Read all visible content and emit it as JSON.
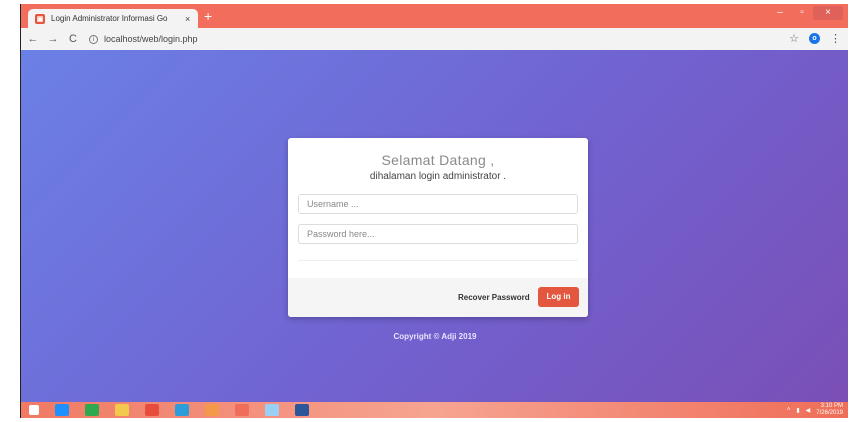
{
  "browser": {
    "tab_title": "Login Administrator Informasi Go",
    "tab_close": "×",
    "new_tab": "+",
    "url": "localhost/web/login.php",
    "nav": {
      "back": "←",
      "forward": "→",
      "reload": "C"
    },
    "profile_initial": "o",
    "window_controls": {
      "minimize": "–",
      "maximize": "▫",
      "close": "×"
    }
  },
  "login": {
    "title": "Selamat Datang ,",
    "subtitle": "dihalaman login administrator .",
    "username_placeholder": "Username ...",
    "password_placeholder": "Password here...",
    "recover_label": "Recover Password",
    "login_label": "Log in"
  },
  "footer": {
    "copyright": "Copyright © Adji 2019"
  },
  "taskbar": {
    "time": "3:10 PM",
    "date": "7/26/2019",
    "apps": [
      {
        "name": "ie-icon",
        "color": "#1e90ff"
      },
      {
        "name": "store-icon",
        "color": "#2fa84f"
      },
      {
        "name": "file-explorer-icon",
        "color": "#f2c94c"
      },
      {
        "name": "chrome-icon",
        "color": "#e74c3c"
      },
      {
        "name": "app-icon",
        "color": "#2d9cdb"
      },
      {
        "name": "xampp-icon",
        "color": "#f2994a"
      },
      {
        "name": "xampp-icon-2",
        "color": "#f06d5b"
      },
      {
        "name": "photos-icon",
        "color": "#9ad0f5"
      },
      {
        "name": "word-icon",
        "color": "#2b579a"
      }
    ]
  },
  "colors": {
    "accent": "#e2573d",
    "titlebar": "#f26d5b",
    "bg_start": "#6b80e6",
    "bg_end": "#7a4fb6"
  }
}
